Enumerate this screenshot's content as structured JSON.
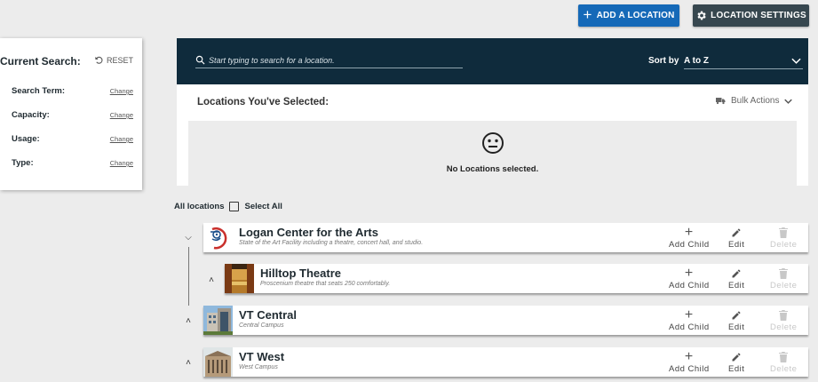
{
  "toolbar": {
    "add_location_label": "ADD A LOCATION",
    "location_settings_label": "LOCATION SETTINGS",
    "accent": "#1569b8",
    "settings_bg": "#37474f"
  },
  "current_search": {
    "title": "Current Search:",
    "reset_label": "RESET",
    "filters": [
      {
        "label": "Search Term:",
        "action": "Change"
      },
      {
        "label": "Capacity:",
        "action": "Change"
      },
      {
        "label": "Usage:",
        "action": "Change"
      },
      {
        "label": "Type:",
        "action": "Change"
      }
    ]
  },
  "search": {
    "placeholder": "Start typing to search for a location.",
    "sort_label": "Sort by",
    "sort_value": "A to Z",
    "header_bg": "#0f2b3c"
  },
  "selected": {
    "title": "Locations You've Selected:",
    "bulk_actions_label": "Bulk Actions",
    "empty_message": "No Locations selected."
  },
  "list": {
    "all_locations_label": "All locations",
    "select_all_label": "Select All",
    "action_labels": {
      "add_child": "Add Child",
      "edit": "Edit",
      "delete": "Delete"
    },
    "locations": [
      {
        "name": "Logan Center for the Arts",
        "description": "State of the Art Facility including a theatre, concert hall, and studio.",
        "expanded": true,
        "thumb_icon": "logan-logo-icon"
      },
      {
        "name": "Hilltop Theatre",
        "description": "Proscenium theatre that seats 250 comfortably.",
        "expanded": false,
        "thumb_icon": "theatre-photo"
      },
      {
        "name": "VT Central",
        "description": "Central Campus",
        "expanded": false,
        "thumb_icon": "building-photo"
      },
      {
        "name": "VT West",
        "description": "West Campus",
        "expanded": false,
        "thumb_icon": "building-photo"
      }
    ]
  }
}
